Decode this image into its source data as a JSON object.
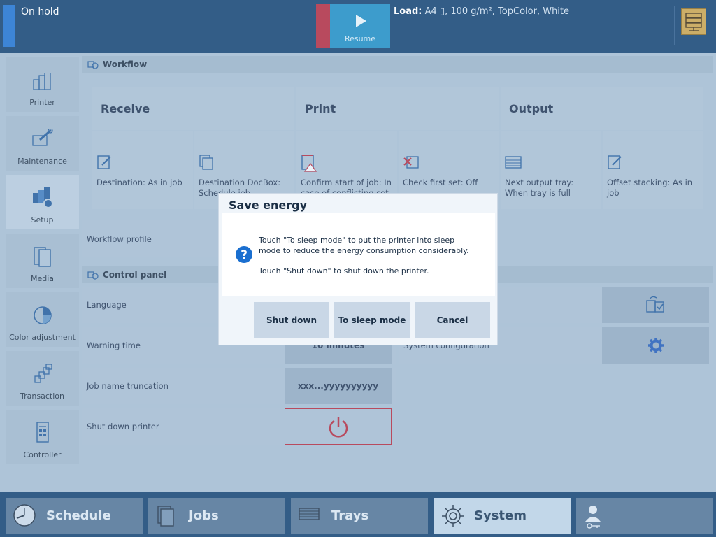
{
  "status": {
    "text": "On hold"
  },
  "resume": {
    "label": "Resume"
  },
  "load": {
    "label": "Load:",
    "value": "A4 ▯, 100 g/m², TopColor, White"
  },
  "sidebar": {
    "items": [
      {
        "label": "Printer",
        "icon": "printer-icon"
      },
      {
        "label": "Maintenance",
        "icon": "maintenance-icon"
      },
      {
        "label": "Setup",
        "icon": "setup-icon",
        "active": true
      },
      {
        "label": "Media",
        "icon": "media-icon"
      },
      {
        "label": "Color adjustment",
        "icon": "color-adjustment-icon"
      },
      {
        "label": "Transaction",
        "icon": "transaction-icon"
      },
      {
        "label": "Controller",
        "icon": "controller-icon"
      }
    ]
  },
  "workflow": {
    "title": "Workflow",
    "stages": [
      "Receive",
      "Print",
      "Output"
    ],
    "cells": [
      "Destination: As in job",
      "Destination DocBox: Schedule job",
      "Confirm start of job: In case of conflicting set",
      "Check first set: Off",
      "Next output tray: When tray is full",
      "Offset stacking: As in job"
    ],
    "profile_label": "Workflow profile"
  },
  "control_panel": {
    "title": "Control panel",
    "rows": [
      {
        "label": "Language"
      },
      {
        "label": "Warning time",
        "value": "10 minutes"
      },
      {
        "label": "Job name truncation",
        "value": "xxx...yyyyyyyyyy"
      },
      {
        "label": "Shut down printer"
      }
    ],
    "right_rows": [
      {
        "label": ""
      },
      {
        "label": "System configuration"
      }
    ]
  },
  "dialog": {
    "title": "Save energy",
    "message1": "Touch \"To sleep mode\" to put the printer into sleep mode to reduce the energy consumption considerably.",
    "message2": "Touch \"Shut down\" to shut down the printer.",
    "buttons": {
      "shutdown": "Shut down",
      "sleep": "To sleep mode",
      "cancel": "Cancel"
    }
  },
  "bottom_tabs": [
    {
      "label": "Schedule",
      "icon": "clock-icon"
    },
    {
      "label": "Jobs",
      "icon": "jobs-icon"
    },
    {
      "label": "Trays",
      "icon": "trays-icon"
    },
    {
      "label": "System",
      "icon": "gear-icon",
      "active": true
    },
    {
      "label": "",
      "icon": "user-key-icon"
    }
  ],
  "colors": {
    "topbar": "#0e3f70",
    "accent": "#1a8bc4",
    "stop": "#b0283e",
    "active_tab": "#bcd3e7"
  }
}
